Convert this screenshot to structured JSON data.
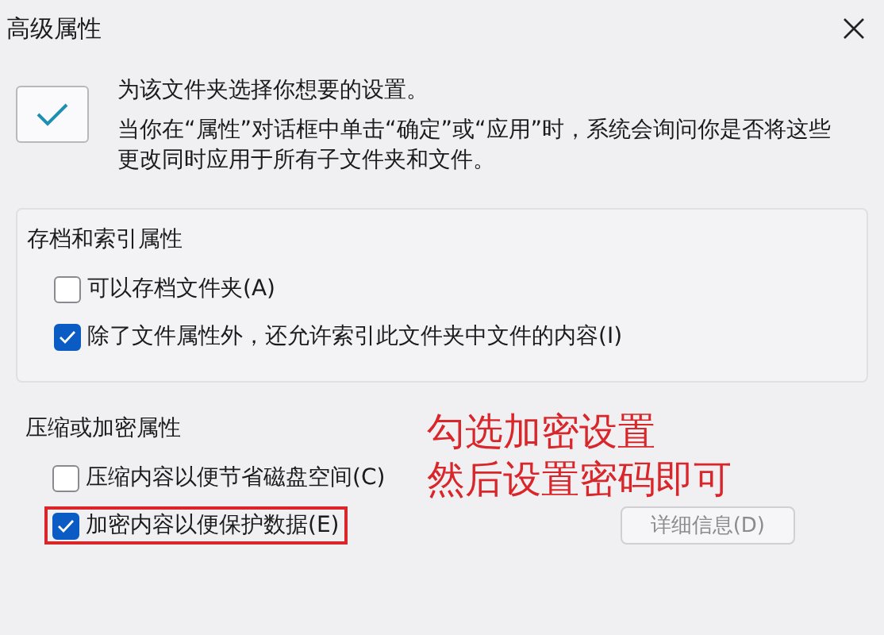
{
  "window": {
    "title": "高级属性"
  },
  "intro": {
    "checked": true,
    "lines": [
      "为该文件夹选择你想要的设置。",
      "当你在“属性”对话框中单击“确定”或“应用”时，系统会询问你是否将这些更改同时应用于所有子文件夹和文件。"
    ]
  },
  "sections": [
    {
      "title": "存档和索引属性",
      "options": [
        {
          "label": "可以存档文件夹(A)",
          "checked": false,
          "highlighted": false
        },
        {
          "label": "除了文件属性外，还允许索引此文件夹中文件的内容(I)",
          "checked": true,
          "highlighted": false
        }
      ]
    },
    {
      "title": "压缩或加密属性",
      "options": [
        {
          "label": "压缩内容以便节省磁盘空间(C)",
          "checked": false,
          "highlighted": false
        },
        {
          "label": "加密内容以便保护数据(E)",
          "checked": true,
          "highlighted": true
        }
      ],
      "button": {
        "label": "详细信息(D)",
        "disabled": true
      }
    }
  ],
  "annotation": {
    "lines": [
      "勾选加密设置",
      "然后设置密码即可"
    ]
  }
}
